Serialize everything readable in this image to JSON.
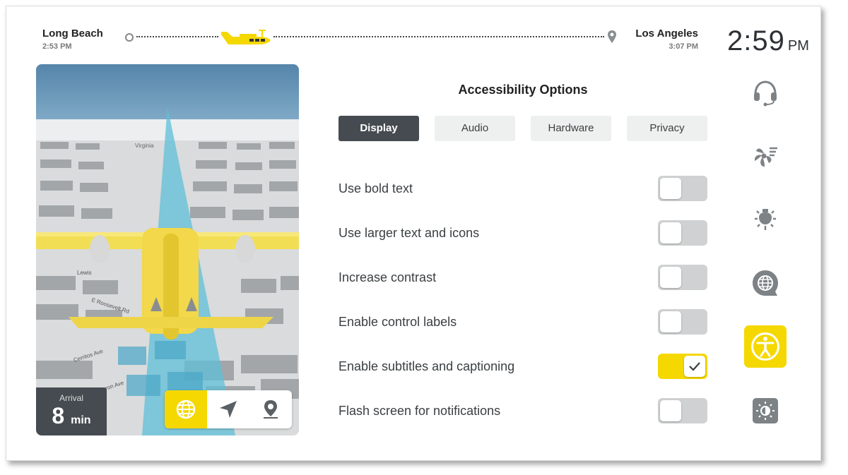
{
  "header": {
    "origin_city": "Long Beach",
    "origin_time": "2:53 PM",
    "dest_city": "Los Angeles",
    "dest_time": "3:07 PM",
    "clock_time": "2:59",
    "clock_ampm": "PM"
  },
  "map": {
    "arrival_label": "Arrival",
    "arrival_value": "8",
    "arrival_unit": "min",
    "street_labels": [
      "Virginia",
      "Lewis",
      "E Roosevelt Rd",
      "Cerritos Ave",
      "Marron Ave"
    ],
    "buttons": [
      {
        "icon": "globe-icon",
        "active": true
      },
      {
        "icon": "navigation-arrow-icon",
        "active": false
      },
      {
        "icon": "location-pin-icon",
        "active": false
      }
    ]
  },
  "settings": {
    "title": "Accessibility Options",
    "tabs": [
      {
        "label": "Display",
        "active": true
      },
      {
        "label": "Audio",
        "active": false
      },
      {
        "label": "Hardware",
        "active": false
      },
      {
        "label": "Privacy",
        "active": false
      }
    ],
    "options": [
      {
        "label": "Use bold text",
        "on": false
      },
      {
        "label": "Use larger text and icons",
        "on": false
      },
      {
        "label": "Increase contrast",
        "on": false
      },
      {
        "label": "Enable control labels",
        "on": false
      },
      {
        "label": "Enable subtitles and captioning",
        "on": true
      },
      {
        "label": "Flash screen for notifications",
        "on": false
      }
    ]
  },
  "rail": [
    {
      "icon": "headset-icon",
      "active": false
    },
    {
      "icon": "fan-icon",
      "active": false
    },
    {
      "icon": "light-bulb-icon",
      "active": false
    },
    {
      "icon": "language-globe-icon",
      "active": false
    },
    {
      "icon": "accessibility-icon",
      "active": true
    },
    {
      "icon": "display-brightness-icon",
      "active": false
    }
  ],
  "colors": {
    "accent": "#f5d800",
    "dark": "#454b50",
    "map_water": "#5b8fb3",
    "flight_beam": "#5fbfd8"
  }
}
